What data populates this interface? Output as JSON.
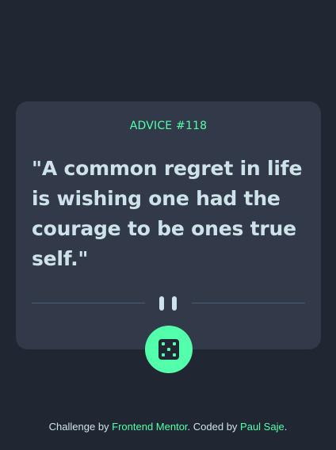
{
  "advice": {
    "label": "ADVICE #118",
    "quote": "\"A common regret in life is wishing one had the courage to be ones true self.\""
  },
  "icons": {
    "divider": "pause-icon",
    "button": "dice-icon"
  },
  "footer": {
    "prefix": "Challenge by ",
    "challenge_link": "Frontend Mentor",
    "middle": ". Coded by ",
    "author_link": "Paul Saje",
    "suffix": "."
  },
  "colors": {
    "background": "#202733",
    "card": "#323a49",
    "accent": "#53ffaa",
    "text": "#cee3e9",
    "divider": "#4f5d74"
  }
}
